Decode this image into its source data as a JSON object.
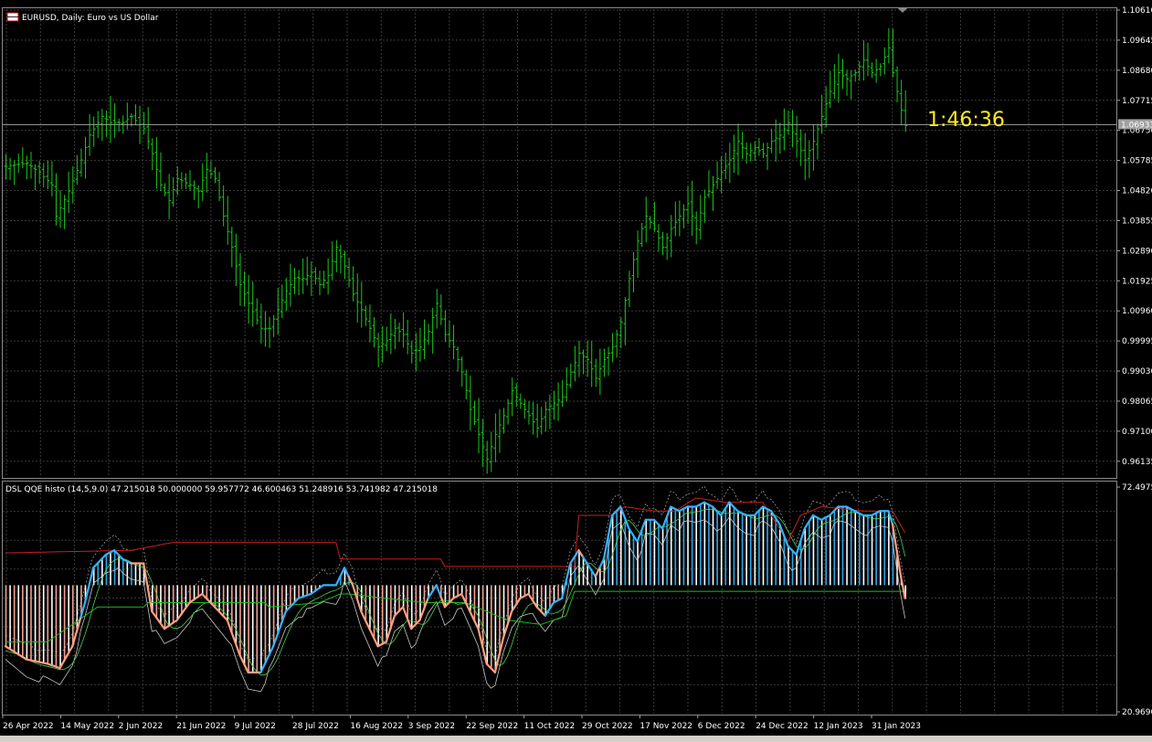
{
  "price_panel": {
    "title": "EURUSD, Daily:  Euro vs US Dollar",
    "current_price_label": "1.06933",
    "timer": "1:46:36"
  },
  "indicator_panel": {
    "title": "DSL QQE histo (14,5,9.0) 47.215018 50.000000 59.957772 46.600463 51.248916 53.741982 47.215018"
  },
  "colors": {
    "background": "#000000",
    "grid": "#3b3b3b",
    "candle": "#19c819",
    "timer": "#ffeb1a",
    "histo_up": "#2aa6ea",
    "histo_neutral": "#ffffff",
    "histo_down": "#f4a08c",
    "qqe_up": "#33b3ff",
    "qqe_down": "#ffa080",
    "level_upper": "#c81e1e",
    "level_lower": "#22b822",
    "bands": "#c8c8c8",
    "signal": "#4cd24c"
  },
  "chart_data": [
    {
      "type": "bar",
      "subtype": "ohlc_price",
      "symbol": "EURUSD",
      "timeframe": "Daily",
      "ylim": [
        0.9566,
        1.1061
      ],
      "y_ticks": [
        "1.10610",
        "1.09645",
        "1.08680",
        "1.07715",
        "1.06750",
        "1.05785",
        "1.04820",
        "1.03855",
        "1.02890",
        "1.01925",
        "1.00960",
        "0.99995",
        "0.99030",
        "0.98065",
        "0.97100",
        "0.96135"
      ],
      "current_price": 1.06933,
      "x_ticks": [
        "26 Apr 2022",
        "14 May 2022",
        "2 Jun 2022",
        "21 Jun 2022",
        "9 Jul 2022",
        "28 Jul 2022",
        "16 Aug 2022",
        "3 Sep 2022",
        "22 Sep 2022",
        "11 Oct 2022",
        "29 Oct 2022",
        "17 Nov 2022",
        "6 Dec 2022",
        "24 Dec 2022",
        "12 Jan 2023",
        "31 Jan 2023"
      ],
      "close_anchors": [
        [
          0,
          1.056
        ],
        [
          5,
          1.057
        ],
        [
          8,
          1.054
        ],
        [
          11,
          1.05
        ],
        [
          12,
          1.04
        ],
        [
          15,
          1.048
        ],
        [
          18,
          1.058
        ],
        [
          20,
          1.066
        ],
        [
          23,
          1.072
        ],
        [
          25,
          1.07
        ],
        [
          28,
          1.07
        ],
        [
          30,
          1.072
        ],
        [
          33,
          1.068
        ],
        [
          35,
          1.06
        ],
        [
          37,
          1.05
        ],
        [
          39,
          1.045
        ],
        [
          41,
          1.052
        ],
        [
          44,
          1.05
        ],
        [
          46,
          1.048
        ],
        [
          48,
          1.055
        ],
        [
          50,
          1.052
        ],
        [
          52,
          1.04
        ],
        [
          54,
          1.03
        ],
        [
          56,
          1.018
        ],
        [
          58,
          1.012
        ],
        [
          61,
          1.004
        ],
        [
          63,
          1.004
        ],
        [
          65,
          1.01
        ],
        [
          67,
          1.016
        ],
        [
          69,
          1.02
        ],
        [
          71,
          1.02
        ],
        [
          73,
          1.022
        ],
        [
          75,
          1.018
        ],
        [
          77,
          1.021
        ],
        [
          79,
          1.03
        ],
        [
          81,
          1.024
        ],
        [
          83,
          1.015
        ],
        [
          85,
          1.01
        ],
        [
          87,
          1.004
        ],
        [
          89,
          0.998
        ],
        [
          91,
          1.0
        ],
        [
          93,
          1.004
        ],
        [
          95,
          1.002
        ],
        [
          97,
          0.996
        ],
        [
          99,
          0.998
        ],
        [
          101,
          1.003
        ],
        [
          103,
          1.012
        ],
        [
          105,
          1.002
        ],
        [
          107,
          0.998
        ],
        [
          109,
          0.99
        ],
        [
          111,
          0.978
        ],
        [
          113,
          0.97
        ],
        [
          115,
          0.962
        ],
        [
          117,
          0.97
        ],
        [
          119,
          0.976
        ],
        [
          121,
          0.984
        ],
        [
          123,
          0.98
        ],
        [
          125,
          0.976
        ],
        [
          127,
          0.972
        ],
        [
          129,
          0.978
        ],
        [
          131,
          0.98
        ],
        [
          133,
          0.982
        ],
        [
          135,
          0.99
        ],
        [
          137,
          0.996
        ],
        [
          139,
          0.994
        ],
        [
          141,
          0.988
        ],
        [
          143,
          0.994
        ],
        [
          145,
          0.998
        ],
        [
          147,
          1.006
        ],
        [
          149,
          1.02
        ],
        [
          151,
          1.032
        ],
        [
          153,
          1.04
        ],
        [
          155,
          1.036
        ],
        [
          157,
          1.03
        ],
        [
          159,
          1.036
        ],
        [
          161,
          1.04
        ],
        [
          163,
          1.044
        ],
        [
          165,
          1.036
        ],
        [
          167,
          1.046
        ],
        [
          169,
          1.05
        ],
        [
          171,
          1.054
        ],
        [
          173,
          1.058
        ],
        [
          175,
          1.064
        ],
        [
          177,
          1.06
        ],
        [
          179,
          1.062
        ],
        [
          181,
          1.06
        ],
        [
          183,
          1.064
        ],
        [
          185,
          1.066
        ],
        [
          187,
          1.07
        ],
        [
          189,
          1.064
        ],
        [
          191,
          1.058
        ],
        [
          193,
          1.064
        ],
        [
          195,
          1.072
        ],
        [
          197,
          1.08
        ],
        [
          199,
          1.086
        ],
        [
          201,
          1.084
        ],
        [
          203,
          1.086
        ],
        [
          205,
          1.09
        ],
        [
          207,
          1.086
        ],
        [
          209,
          1.088
        ],
        [
          211,
          1.094
        ],
        [
          212,
          1.086
        ],
        [
          213,
          1.08
        ],
        [
          214,
          1.074
        ],
        [
          215,
          1.069
        ]
      ]
    },
    {
      "type": "bar",
      "subtype": "oscillator_histogram",
      "name": "DSL QQE histo (14,5,9.0)",
      "ylim": [
        20.969,
        72.4975
      ],
      "y_ticks": [
        "72.4975",
        "20.9690"
      ],
      "zero_line": 50.0,
      "qqe_anchors": [
        [
          0,
          36
        ],
        [
          5,
          33
        ],
        [
          10,
          32
        ],
        [
          13,
          31
        ],
        [
          16,
          36
        ],
        [
          19,
          46
        ],
        [
          21,
          54
        ],
        [
          24,
          57
        ],
        [
          26,
          58
        ],
        [
          28,
          56
        ],
        [
          30,
          55
        ],
        [
          33,
          55
        ],
        [
          35,
          44
        ],
        [
          38,
          40
        ],
        [
          41,
          42
        ],
        [
          44,
          46
        ],
        [
          47,
          48
        ],
        [
          50,
          45
        ],
        [
          53,
          42
        ],
        [
          56,
          34
        ],
        [
          58,
          30
        ],
        [
          61,
          30
        ],
        [
          64,
          36
        ],
        [
          67,
          44
        ],
        [
          70,
          47
        ],
        [
          73,
          48
        ],
        [
          76,
          50
        ],
        [
          79,
          50
        ],
        [
          81,
          54
        ],
        [
          83,
          50
        ],
        [
          85,
          44
        ],
        [
          87,
          40
        ],
        [
          89,
          36
        ],
        [
          91,
          37
        ],
        [
          93,
          43
        ],
        [
          95,
          45
        ],
        [
          97,
          40
        ],
        [
          99,
          42
        ],
        [
          101,
          47
        ],
        [
          103,
          50
        ],
        [
          105,
          45
        ],
        [
          107,
          47
        ],
        [
          109,
          48
        ],
        [
          111,
          44
        ],
        [
          113,
          40
        ],
        [
          115,
          32
        ],
        [
          117,
          30
        ],
        [
          119,
          38
        ],
        [
          121,
          44
        ],
        [
          123,
          47
        ],
        [
          125,
          48
        ],
        [
          127,
          45
        ],
        [
          129,
          43
        ],
        [
          131,
          46
        ],
        [
          133,
          47
        ],
        [
          135,
          55
        ],
        [
          137,
          58
        ],
        [
          139,
          55
        ],
        [
          141,
          52
        ],
        [
          143,
          56
        ],
        [
          145,
          66
        ],
        [
          147,
          68
        ],
        [
          149,
          63
        ],
        [
          151,
          60
        ],
        [
          153,
          65
        ],
        [
          155,
          65
        ],
        [
          157,
          63
        ],
        [
          159,
          68
        ],
        [
          161,
          67
        ],
        [
          163,
          68
        ],
        [
          165,
          68
        ],
        [
          167,
          69
        ],
        [
          169,
          68
        ],
        [
          171,
          66
        ],
        [
          173,
          69
        ],
        [
          175,
          67
        ],
        [
          177,
          66
        ],
        [
          179,
          66
        ],
        [
          181,
          68
        ],
        [
          183,
          67
        ],
        [
          185,
          64
        ],
        [
          187,
          59
        ],
        [
          189,
          57
        ],
        [
          191,
          63
        ],
        [
          193,
          66
        ],
        [
          195,
          65
        ],
        [
          197,
          66
        ],
        [
          199,
          68
        ],
        [
          201,
          68
        ],
        [
          203,
          67
        ],
        [
          205,
          66
        ],
        [
          207,
          66
        ],
        [
          209,
          67
        ],
        [
          211,
          67
        ],
        [
          212,
          64
        ],
        [
          213,
          58
        ],
        [
          214,
          52
        ],
        [
          215,
          47
        ]
      ],
      "trend_up_ranges": [
        [
          19,
          30
        ],
        [
          62,
          82
        ],
        [
          102,
          104
        ],
        [
          130,
          137
        ],
        [
          139,
          141
        ],
        [
          143,
          212
        ]
      ],
      "upper_level": {
        "value": 57.4,
        "from": 0,
        "to": 215,
        "steps": [
          [
            0,
            57.4
          ],
          [
            30,
            58.0
          ],
          [
            40,
            59.8
          ],
          [
            79,
            59.8
          ],
          [
            80,
            56.0
          ],
          [
            104,
            56.0
          ],
          [
            105,
            54.3
          ],
          [
            136,
            54.3
          ],
          [
            137,
            66
          ],
          [
            145,
            66
          ],
          [
            148,
            68
          ],
          [
            155,
            67
          ],
          [
            160,
            67
          ],
          [
            165,
            70
          ],
          [
            172,
            69
          ],
          [
            181,
            69
          ],
          [
            183,
            66
          ],
          [
            187,
            60
          ],
          [
            190,
            66
          ],
          [
            195,
            68
          ],
          [
            205,
            67
          ],
          [
            212,
            67
          ],
          [
            215,
            62
          ]
        ]
      },
      "lower_level": {
        "value": 48.6,
        "from": 0,
        "to": 215,
        "steps": [
          [
            0,
            37
          ],
          [
            10,
            37
          ],
          [
            22,
            45
          ],
          [
            23,
            45
          ],
          [
            33,
            45
          ],
          [
            34,
            46
          ],
          [
            62,
            46
          ],
          [
            63,
            45
          ],
          [
            75,
            46
          ],
          [
            80,
            48
          ],
          [
            82,
            48
          ],
          [
            100,
            46
          ],
          [
            110,
            46
          ],
          [
            120,
            42
          ],
          [
            128,
            41
          ],
          [
            134,
            43
          ],
          [
            136,
            48.6
          ],
          [
            215,
            48.6
          ]
        ]
      }
    }
  ]
}
